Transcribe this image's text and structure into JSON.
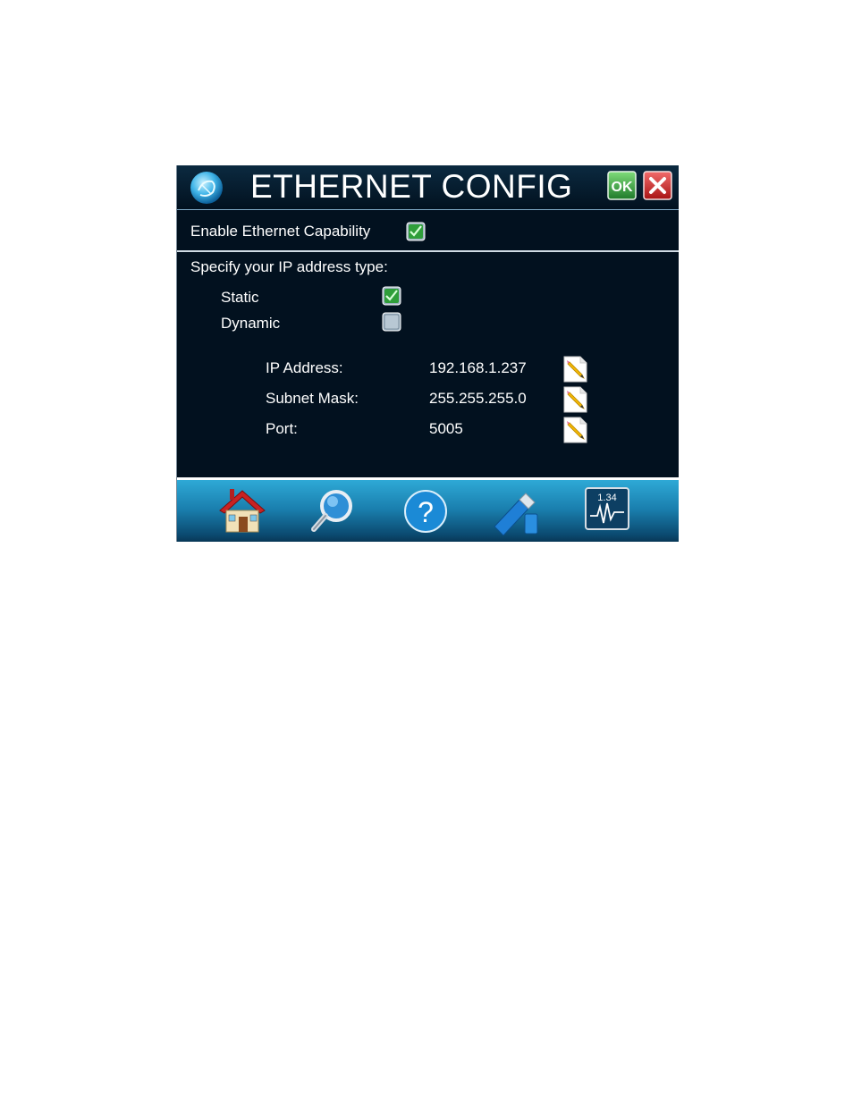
{
  "header": {
    "title": "ETHERNET CONFIG",
    "ok_label": "OK",
    "logo_icon": "globe-logo-icon",
    "cancel_icon": "close-icon"
  },
  "enable": {
    "label": "Enable Ethernet Capability",
    "checked": true
  },
  "ip_type": {
    "prompt": "Specify your IP address type:",
    "options": [
      {
        "label": "Static",
        "checked": true
      },
      {
        "label": "Dynamic",
        "checked": false
      }
    ]
  },
  "fields": [
    {
      "label": "IP Address:",
      "value": "192.168.1.237",
      "edit_icon": "pencil-edit-icon"
    },
    {
      "label": "Subnet Mask:",
      "value": "255.255.255.0",
      "edit_icon": "pencil-edit-icon"
    },
    {
      "label": "Port:",
      "value": "5005",
      "edit_icon": "pencil-edit-icon"
    }
  ],
  "footer": {
    "monitor_readout": "1.34",
    "icons": [
      "home-icon",
      "search-icon",
      "help-icon",
      "usb-drive-icon",
      "monitor-icon"
    ]
  },
  "colors": {
    "background": "#02111f",
    "accent": "#2ea9d6",
    "ok_green": "#2f9e3a",
    "cancel_red": "#d42a2a"
  }
}
